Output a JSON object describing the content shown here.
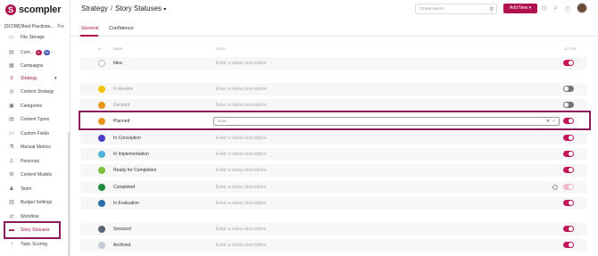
{
  "app": {
    "name": "scompler"
  },
  "sidebar": {
    "top_item": "File Storage",
    "workspace": {
      "name": "[SCOM] Best Practices...",
      "plan": "Pro"
    },
    "items": [
      {
        "label": "Com...",
        "badge1": "8",
        "badge2": "28",
        "icon": "bell-icon"
      },
      {
        "label": "Campaigns",
        "icon": "campaign-icon"
      },
      {
        "label": "Strategy",
        "icon": "strategy-icon"
      },
      {
        "label": "Content Strategy",
        "icon": "target-icon"
      },
      {
        "label": "Categories",
        "icon": "categories-icon"
      },
      {
        "label": "Content Types",
        "icon": "content-types-icon"
      },
      {
        "label": "Custom Fields",
        "icon": "custom-fields-icon"
      },
      {
        "label": "Manual Metrics",
        "icon": "metrics-icon"
      },
      {
        "label": "Personas",
        "icon": "persona-icon"
      },
      {
        "label": "Content Models",
        "icon": "models-icon"
      },
      {
        "label": "Team",
        "icon": "team-icon"
      },
      {
        "label": "Budget Settings",
        "icon": "budget-icon"
      },
      {
        "label": "Workflow",
        "icon": "workflow-icon"
      },
      {
        "label": "Story Statuses",
        "icon": "statuses-icon"
      },
      {
        "label": "Topic Scoring",
        "icon": "scoring-icon"
      }
    ]
  },
  "header": {
    "breadcrumb_parent": "Strategy",
    "breadcrumb_sep": "/",
    "breadcrumb_current": "Story Statuses",
    "search_placeholder": "Global search",
    "add_new_label": "Add New"
  },
  "tabs": [
    {
      "label": "General"
    },
    {
      "label": "Confidence"
    }
  ],
  "table": {
    "col_name": "NAME",
    "col_note": "NOTE",
    "col_active": "ACTIVE",
    "note_placeholder": "Enter a status description",
    "edit_placeholder": "Note...",
    "rows": [
      {
        "name": "Idea",
        "color": "#ffffff",
        "active": "on"
      },
      {
        "name": "In Review",
        "color": "#f2c200",
        "active": "off"
      },
      {
        "name": "Decided",
        "color": "#e8951c",
        "active": "off"
      },
      {
        "name": "Planned",
        "color": "#e8951c",
        "active": "on"
      },
      {
        "name": "In Conception",
        "color": "#4a3fc6",
        "active": "on"
      },
      {
        "name": "In Implementation",
        "color": "#4fb3d9",
        "active": "on"
      },
      {
        "name": "Ready for Completion",
        "color": "#7fbf3a",
        "active": "on"
      },
      {
        "name": "Completed",
        "color": "#1e8a3c",
        "active": "light"
      },
      {
        "name": "In Evaluation",
        "color": "#2c6fa8",
        "active": "on"
      },
      {
        "name": "Snoozed",
        "color": "#5a6675",
        "active": "on"
      },
      {
        "name": "Archived",
        "color": "#c5cad6",
        "active": "on"
      }
    ]
  }
}
